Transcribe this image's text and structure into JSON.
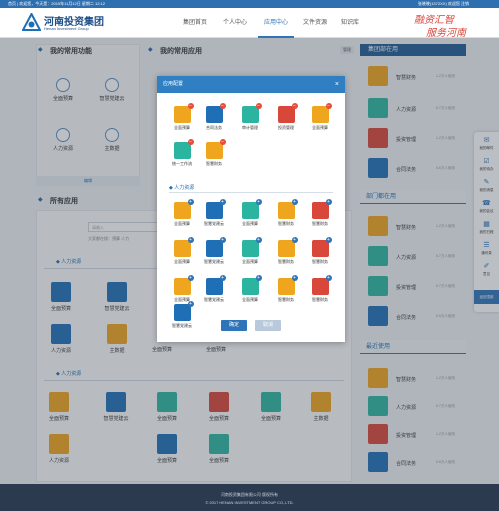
{
  "topbar": {
    "left": "首页 | 欢迎您，今天是：2019年11月12日 星期二 12:12",
    "right": "张晓晓(1372XX) 欢迎您  注销"
  },
  "brand": {
    "name_cn": "河南投资集团",
    "name_en": "Henan Investment Group",
    "slogan1": "融资汇智",
    "slogan2": "服务河南"
  },
  "nav": [
    {
      "label": "集团首页"
    },
    {
      "label": "个人中心"
    },
    {
      "label": "应用中心"
    },
    {
      "label": "文件资源"
    },
    {
      "label": "知识库"
    }
  ],
  "my_funcs": {
    "title": "我的常用功能",
    "items": [
      {
        "label": "全面预算"
      },
      {
        "label": "智慧党建云"
      },
      {
        "label": "人力资源"
      },
      {
        "label": "主数据"
      }
    ],
    "edit": "编辑"
  },
  "my_apps": {
    "title": "我的常用应用",
    "manage": "管理"
  },
  "all_apps": {
    "title": "所有应用",
    "search_placeholder": "请输入",
    "search_btn": "搜索",
    "hint": "大家都在搜：预算  人力",
    "groups": [
      {
        "title": "人力资源",
        "items": [
          {
            "label": "全面预算"
          },
          {
            "label": "智慧党建云"
          },
          {
            "label": "人力资源"
          },
          {
            "label": "主数据"
          }
        ]
      },
      {
        "title": "人力资源",
        "items": [
          {
            "label": "全面预算"
          },
          {
            "label": "智慧党建云"
          },
          {
            "label": "全面预算"
          },
          {
            "label": "全面预算"
          },
          {
            "label": "全面预算"
          },
          {
            "label": "主数据"
          },
          {
            "label": "人力资源"
          },
          {
            "label": "全面预算"
          },
          {
            "label": "全面预算"
          }
        ]
      }
    ]
  },
  "modal": {
    "title": "应用配置",
    "row1": [
      {
        "label": "全面预算"
      },
      {
        "label": "合同法务"
      },
      {
        "label": "审计管理"
      },
      {
        "label": "投资管理"
      },
      {
        "label": "全面预算"
      }
    ],
    "row2": [
      {
        "label": "统一工作流"
      },
      {
        "label": "智慧财务"
      }
    ],
    "section": "人力资源",
    "grid": [
      {
        "label": "全面预算"
      },
      {
        "label": "智慧党建云"
      },
      {
        "label": "全面预算"
      },
      {
        "label": "智慧财务"
      },
      {
        "label": "智慧财务"
      },
      {
        "label": "全面预算"
      },
      {
        "label": "智慧党建云"
      },
      {
        "label": "全面预算"
      },
      {
        "label": "智慧财务"
      },
      {
        "label": "智慧财务"
      },
      {
        "label": "全面预算"
      },
      {
        "label": "智慧党建云"
      },
      {
        "label": "全面预算"
      },
      {
        "label": "智慧财务"
      },
      {
        "label": "智慧财务"
      },
      {
        "label": "智慧党建云"
      }
    ],
    "ok": "确定",
    "cancel": "取消"
  },
  "group_common": {
    "title": "集团部在用",
    "items": [
      {
        "label": "智慧财务",
        "meta": "1.2万人使用"
      },
      {
        "label": "人力资源",
        "meta": "6.7万人使用"
      },
      {
        "label": "投资管理",
        "meta": "1.2万人使用"
      },
      {
        "label": "合同法务",
        "meta": "6.6万人使用"
      }
    ]
  },
  "dept_common": {
    "title": "部门都在用",
    "items": [
      {
        "label": "智慧财务",
        "meta": "1.2万人使用"
      },
      {
        "label": "人力资源",
        "meta": "6.7万人使用"
      },
      {
        "label": "投资管理",
        "meta": "6.7万人使用"
      },
      {
        "label": "合同法务",
        "meta": "6.6万人使用"
      }
    ]
  },
  "recent": {
    "title": "最近使用",
    "items": [
      {
        "label": "智慧财务",
        "meta": "1.2万人使用"
      },
      {
        "label": "人力资源",
        "meta": "6.7万人使用"
      },
      {
        "label": "投资管理",
        "meta": "1.2万人使用"
      },
      {
        "label": "合同法务",
        "meta": "6.6万人使用"
      }
    ]
  },
  "floatbar": [
    {
      "label": "我的邮件"
    },
    {
      "label": "我的待办"
    },
    {
      "label": "我的消息"
    },
    {
      "label": "我的会议"
    },
    {
      "label": "我的日程"
    },
    {
      "label": "通讯录"
    },
    {
      "label": "意见"
    },
    {
      "label": "返回顶部"
    }
  ],
  "footer": {
    "line1": "河南投资集团有限公司 版权所有",
    "line2": "© 2017 HENAN INVESTMENT GROUP CO.,LTD."
  },
  "colors": {
    "orange": "#f0a51e",
    "blue": "#1f6fb7",
    "teal": "#2bb5a0",
    "red": "#d9463a",
    "gray": "#7f8a96"
  }
}
